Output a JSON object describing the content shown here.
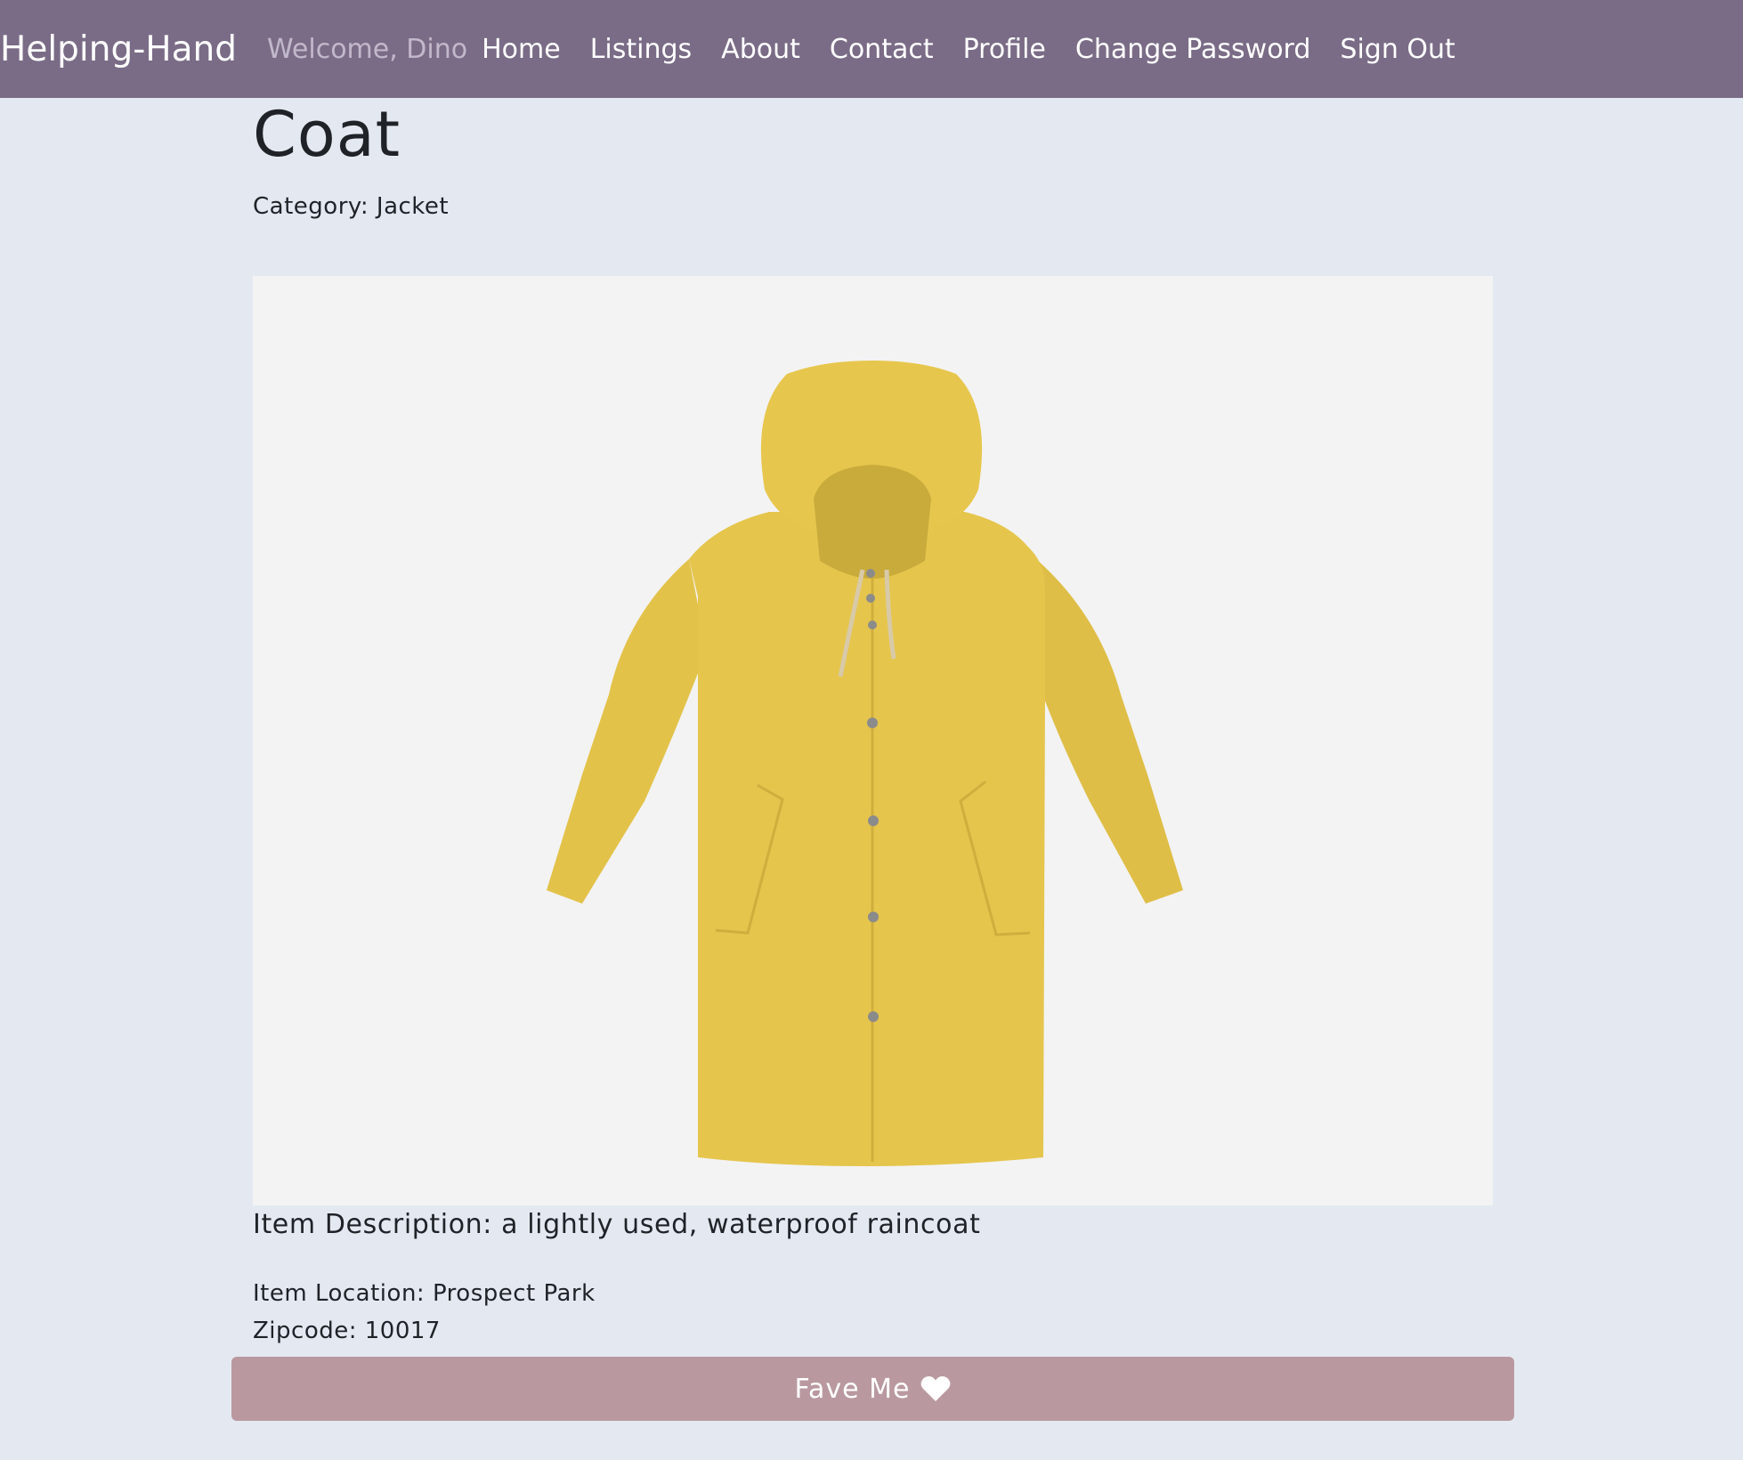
{
  "navbar": {
    "brand": "Helping-Hand",
    "welcome": "Welcome, Dino",
    "links": {
      "home": "Home",
      "listings": "Listings",
      "about": "About",
      "contact": "Contact",
      "profile": "Profile",
      "change_password": "Change Password",
      "sign_out": "Sign Out"
    }
  },
  "item": {
    "title": "Coat",
    "category": "Category: Jacket",
    "image_subject": "yellow-raincoat",
    "description": "Item Description: a lightly used, waterproof raincoat",
    "location": "Item Location: Prospect Park",
    "zipcode": "Zipcode: 10017"
  },
  "actions": {
    "fave_label": "Fave Me",
    "fave_icon": "heart-icon"
  },
  "colors": {
    "navbar": "#7a6c86",
    "page_background": "#e4e9f1",
    "fave_button": "#b9999f",
    "image_background": "#f3f3f3"
  }
}
